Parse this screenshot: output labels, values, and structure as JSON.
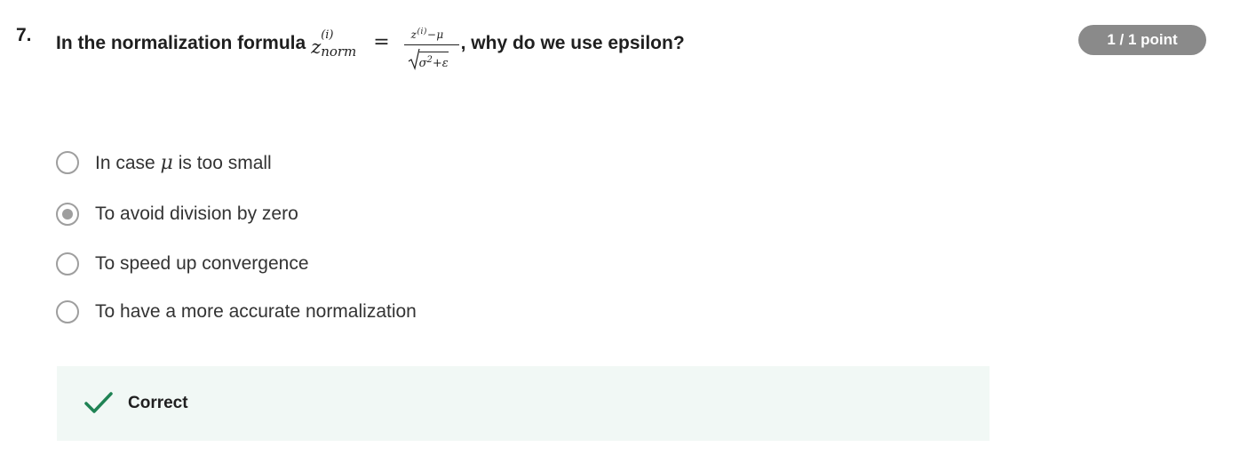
{
  "question": {
    "number": "7.",
    "prefix": "In the normalization formula",
    "formula": {
      "z_base": "z",
      "z_sup": "(i)",
      "z_sub": "norm",
      "equals": "=",
      "numerator": "z(i)−μ",
      "denominator": "σ2+ε"
    },
    "suffix": ", why do we use epsilon?"
  },
  "score_badge": "1 / 1 point",
  "options": [
    {
      "prefix": "In case ",
      "symbol": "μ",
      "suffix": " is too small",
      "selected": false
    },
    {
      "label": "To avoid division by zero",
      "selected": true
    },
    {
      "label": "To speed up convergence",
      "selected": false
    },
    {
      "label": "To have a more accurate normalization",
      "selected": false
    }
  ],
  "feedback": {
    "status": "Correct",
    "icon": "checkmark-icon",
    "accent_color": "#1f8354",
    "background_color": "#f1f8f5"
  },
  "colors": {
    "badge_background": "#8a8a8a",
    "radio_border": "#9e9e9e"
  }
}
